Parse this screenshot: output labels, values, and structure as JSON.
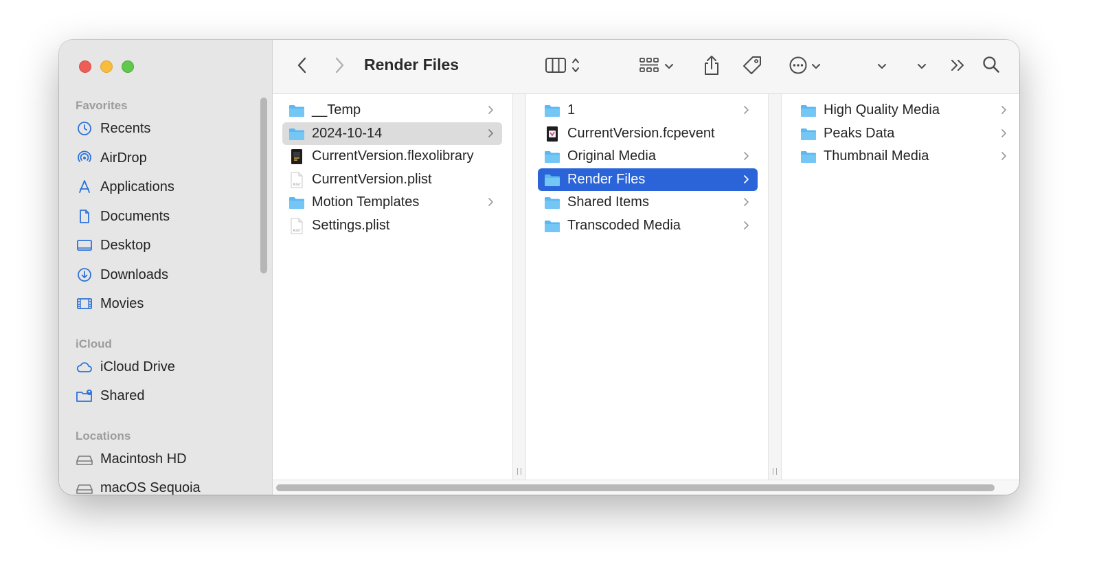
{
  "window": {
    "title": "Render Files"
  },
  "sidebar": {
    "sections": [
      {
        "label": "Favorites"
      },
      {
        "label": "iCloud"
      },
      {
        "label": "Locations"
      }
    ],
    "favorites": [
      {
        "label": "Recents",
        "icon": "clock-icon"
      },
      {
        "label": "AirDrop",
        "icon": "airdrop-icon"
      },
      {
        "label": "Applications",
        "icon": "applications-icon"
      },
      {
        "label": "Documents",
        "icon": "document-icon"
      },
      {
        "label": "Desktop",
        "icon": "desktop-icon"
      },
      {
        "label": "Downloads",
        "icon": "downloads-icon"
      },
      {
        "label": "Movies",
        "icon": "film-icon"
      }
    ],
    "icloud": [
      {
        "label": "iCloud Drive",
        "icon": "cloud-icon"
      },
      {
        "label": "Shared",
        "icon": "shared-folder-icon"
      }
    ],
    "locations": [
      {
        "label": "Macintosh HD",
        "icon": "drive-icon"
      },
      {
        "label": "macOS Sequoia",
        "icon": "drive-icon"
      }
    ]
  },
  "toolbar": {
    "back_icon": "chevron-left-icon",
    "forward_icon": "chevron-right-icon",
    "view_icon": "column-view-icon",
    "group_icon": "grid-group-icon",
    "share_icon": "share-icon",
    "tag_icon": "tag-icon",
    "more_icon": "ellipsis-circle-icon",
    "overflow_icon": "double-chevron-icon",
    "search_icon": "search-icon"
  },
  "columns": [
    {
      "items": [
        {
          "name": "__Temp",
          "type": "folder",
          "has_children": true
        },
        {
          "name": "2024-10-14",
          "type": "folder",
          "has_children": true,
          "selected": "inactive"
        },
        {
          "name": "CurrentVersion.flexolibrary",
          "type": "library",
          "has_children": false
        },
        {
          "name": "CurrentVersion.plist",
          "type": "plist",
          "has_children": false
        },
        {
          "name": "Motion Templates",
          "type": "folder",
          "has_children": true
        },
        {
          "name": "Settings.plist",
          "type": "plist",
          "has_children": false
        }
      ]
    },
    {
      "items": [
        {
          "name": "1",
          "type": "folder",
          "has_children": true
        },
        {
          "name": "CurrentVersion.fcpevent",
          "type": "event",
          "has_children": false
        },
        {
          "name": "Original Media",
          "type": "folder",
          "has_children": true
        },
        {
          "name": "Render Files",
          "type": "folder",
          "has_children": true,
          "selected": "active"
        },
        {
          "name": "Shared Items",
          "type": "folder",
          "has_children": true
        },
        {
          "name": "Transcoded Media",
          "type": "folder",
          "has_children": true
        }
      ]
    },
    {
      "items": [
        {
          "name": "High Quality Media",
          "type": "folder",
          "has_children": true
        },
        {
          "name": "Peaks Data",
          "type": "folder",
          "has_children": true
        },
        {
          "name": "Thumbnail Media",
          "type": "folder",
          "has_children": true
        }
      ]
    }
  ],
  "colors": {
    "accent": "#2a64d8",
    "folder": "#5cb8f0",
    "sidebar_icon": "#2d72d9"
  }
}
